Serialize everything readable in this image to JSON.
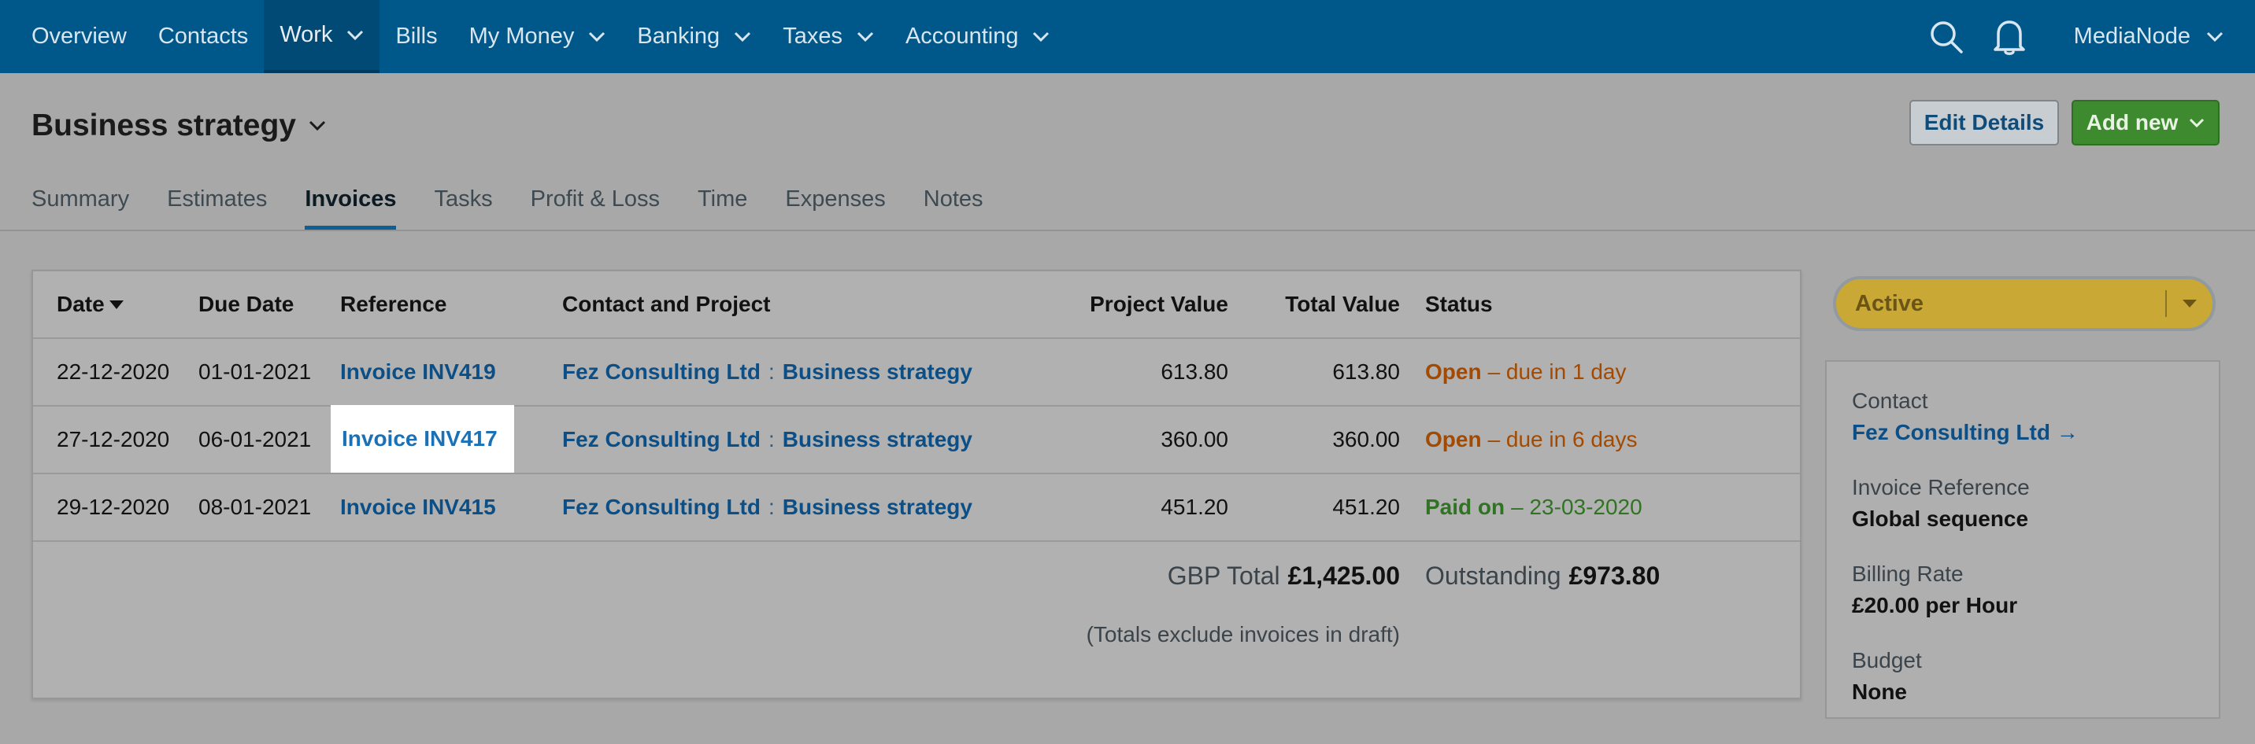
{
  "nav": {
    "items": [
      {
        "label": "Overview",
        "has_menu": false
      },
      {
        "label": "Contacts",
        "has_menu": false
      },
      {
        "label": "Work",
        "has_menu": true,
        "active": true
      },
      {
        "label": "Bills",
        "has_menu": false
      },
      {
        "label": "My Money",
        "has_menu": true
      },
      {
        "label": "Banking",
        "has_menu": true
      },
      {
        "label": "Taxes",
        "has_menu": true
      },
      {
        "label": "Accounting",
        "has_menu": true
      }
    ],
    "account_label": "MediaNode",
    "icons": [
      "search-icon",
      "bell-icon"
    ],
    "bg_color": "#00578a"
  },
  "header": {
    "title": "Business strategy",
    "edit_button": "Edit Details",
    "add_button": "Add new"
  },
  "tabs": [
    {
      "label": "Summary"
    },
    {
      "label": "Estimates"
    },
    {
      "label": "Invoices",
      "active": true
    },
    {
      "label": "Tasks"
    },
    {
      "label": "Profit & Loss"
    },
    {
      "label": "Time"
    },
    {
      "label": "Expenses"
    },
    {
      "label": "Notes"
    }
  ],
  "table": {
    "columns": {
      "date": "Date",
      "due_date": "Due Date",
      "reference": "Reference",
      "contact_project": "Contact and Project",
      "project_value": "Project Value",
      "total_value": "Total Value",
      "status": "Status"
    },
    "rows": [
      {
        "date": "22-12-2020",
        "due": "01-01-2021",
        "ref": "Invoice INV419",
        "contact": "Fez Consulting Ltd",
        "sep": ":",
        "project": "Business strategy",
        "project_value": "613.80",
        "total_value": "613.80",
        "status": "Open",
        "status_detail": "– due in 1 day",
        "status_kind": "open"
      },
      {
        "date": "27-12-2020",
        "due": "06-01-2021",
        "ref": "Invoice INV417",
        "contact": "Fez Consulting Ltd",
        "sep": ":",
        "project": "Business strategy",
        "project_value": "360.00",
        "total_value": "360.00",
        "status": "Open",
        "status_detail": "– due in 6 days",
        "status_kind": "open"
      },
      {
        "date": "29-12-2020",
        "due": "08-01-2021",
        "ref": "Invoice INV415",
        "contact": "Fez Consulting Ltd",
        "sep": ":",
        "project": "Business strategy",
        "project_value": "451.20",
        "total_value": "451.20",
        "status": "Paid on",
        "status_detail": "– 23-03-2020",
        "status_kind": "paid"
      }
    ],
    "totals": {
      "gbp_label": "GBP Total",
      "gbp_value": "£1,425.00",
      "outstanding_label": "Outstanding",
      "outstanding_value": "£973.80"
    },
    "note": "(Totals exclude invoices in draft)"
  },
  "sidebar": {
    "status_select": "Active",
    "contact_label": "Contact",
    "contact_value": "Fez Consulting Ltd →",
    "invoice_ref_label": "Invoice Reference",
    "invoice_ref_value": "Global sequence",
    "billing_rate_label": "Billing Rate",
    "billing_rate_value": "£20.00 per Hour",
    "budget_label": "Budget",
    "budget_value": "None"
  }
}
